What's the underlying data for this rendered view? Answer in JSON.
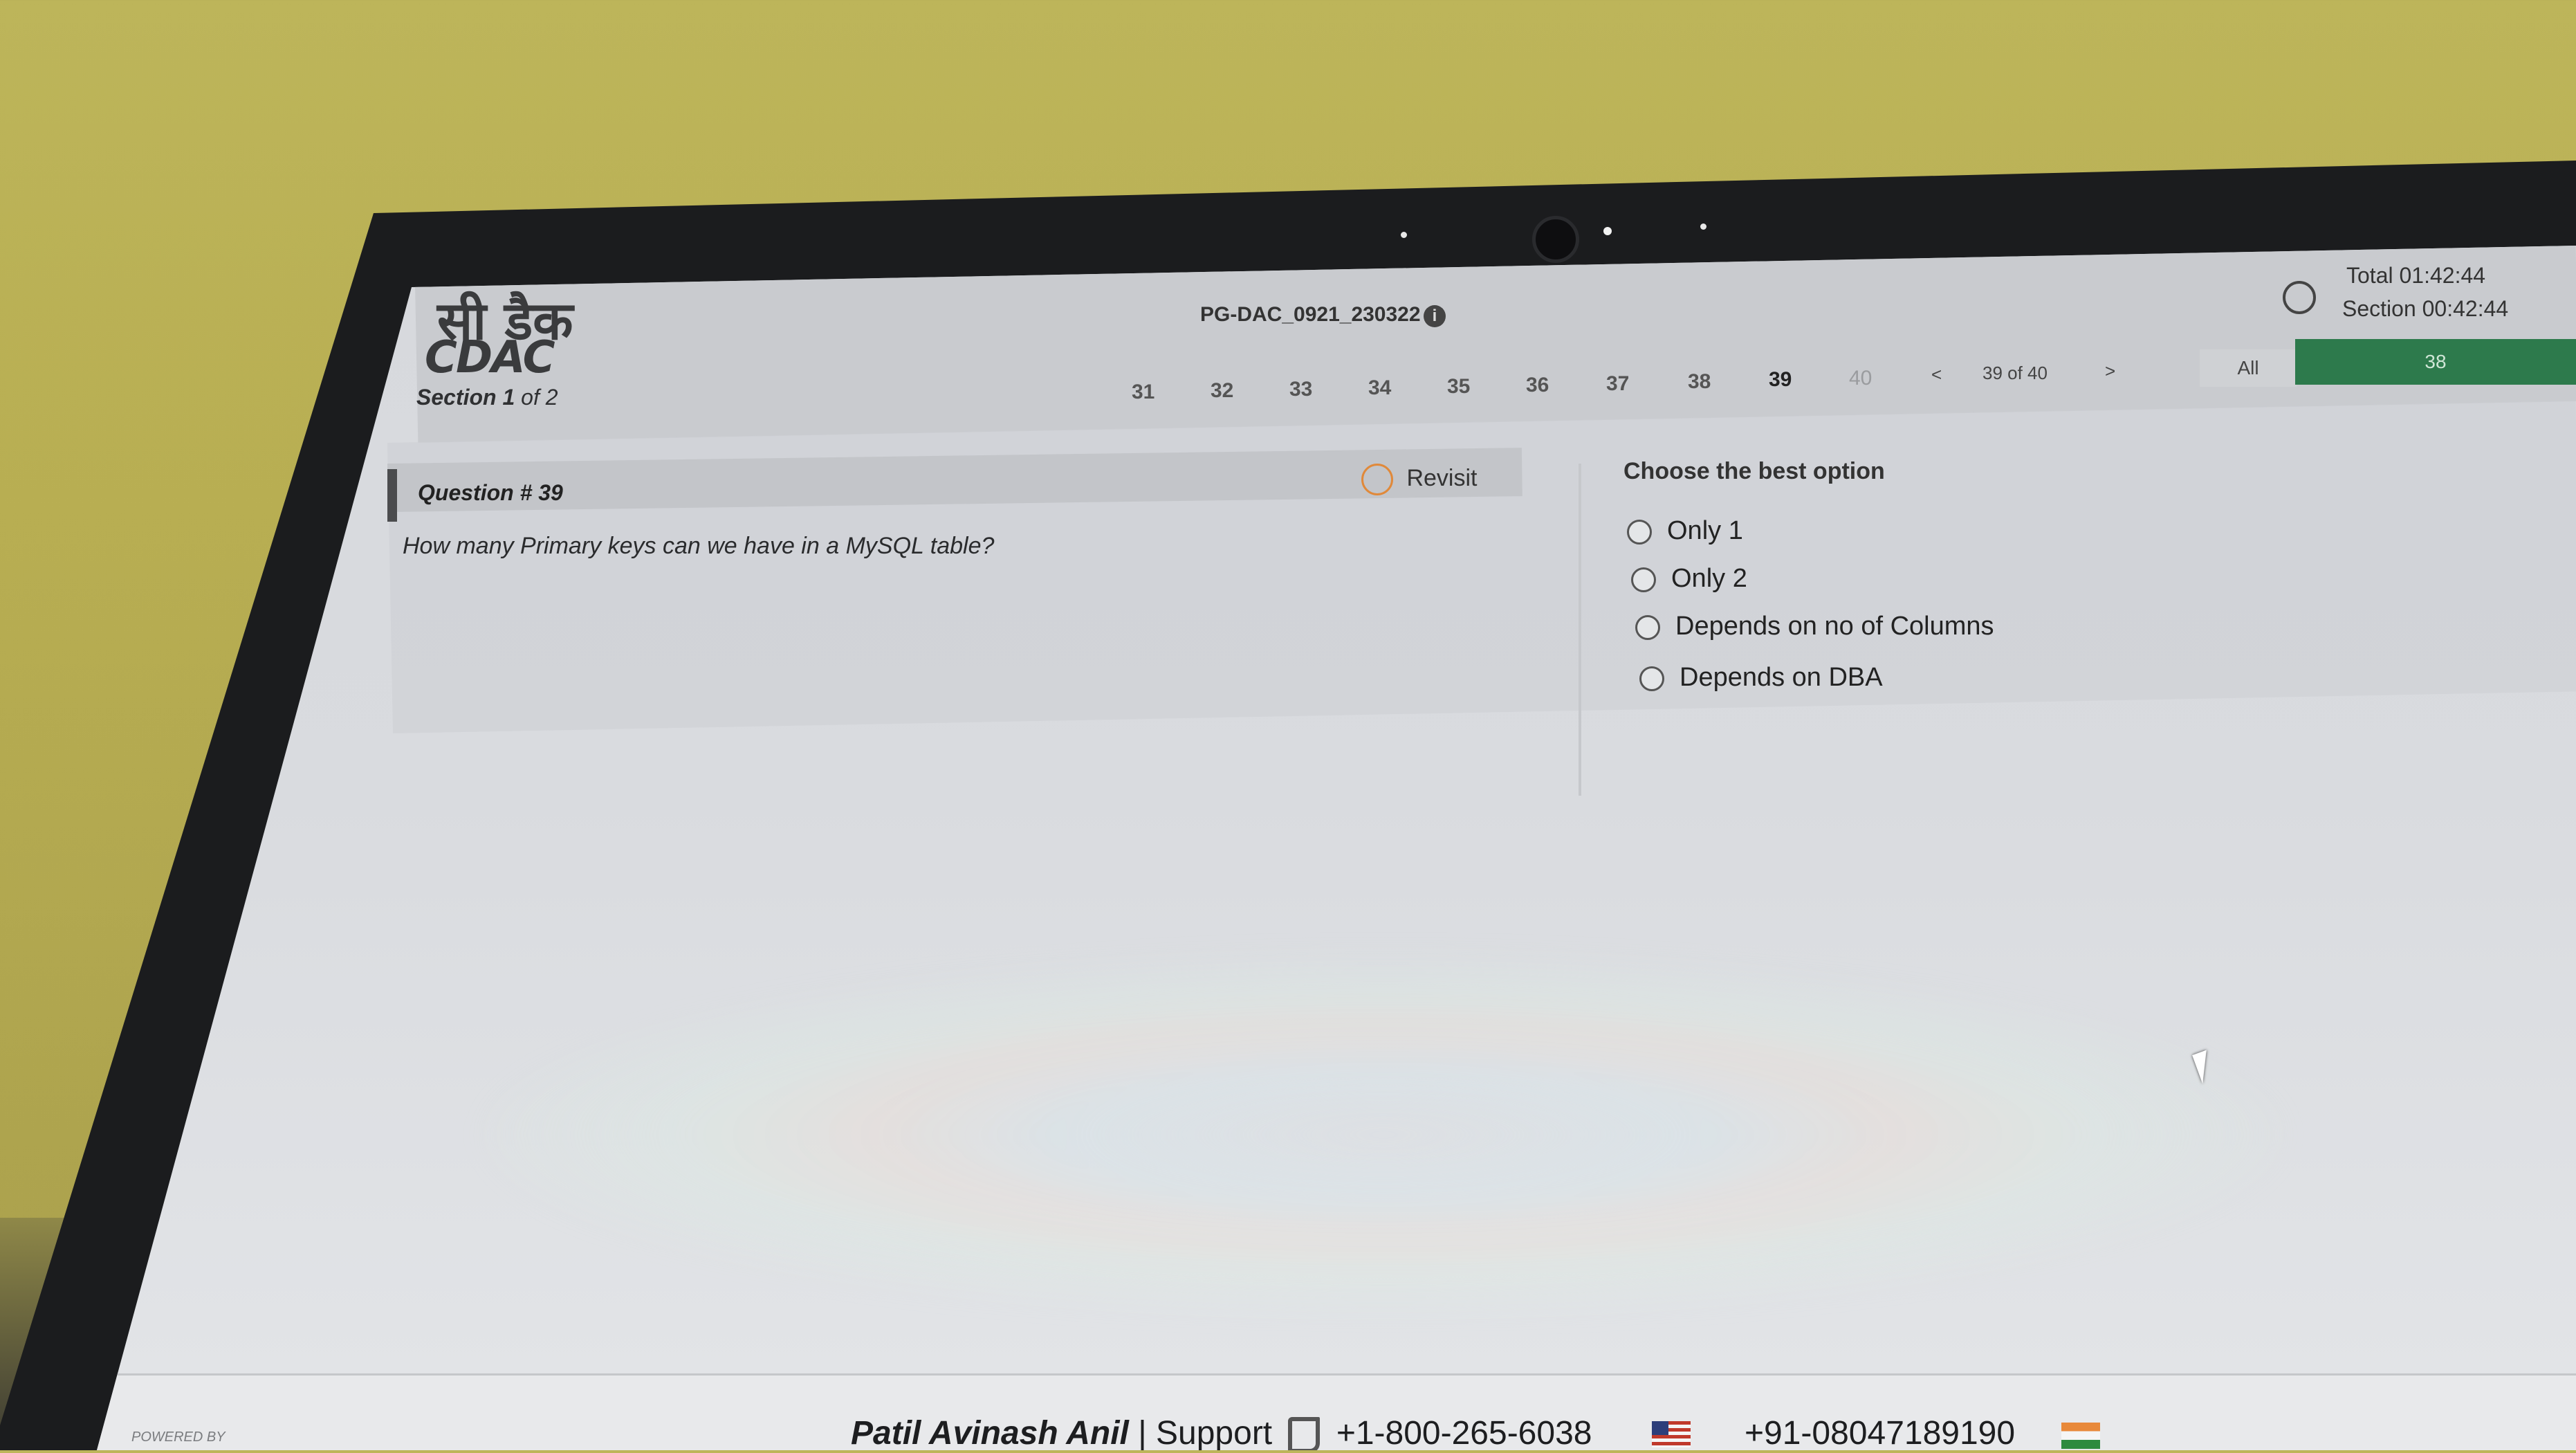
{
  "header": {
    "logo_hindi": "सी डैक",
    "logo_english": "CDAC",
    "section_prefix": "Section",
    "section_current": "1",
    "section_suffix": "of 2",
    "test_id": "PG-DAC_0921_230322",
    "info_glyph": "i"
  },
  "question_nav": {
    "numbers": [
      "31",
      "32",
      "33",
      "34",
      "35",
      "36",
      "37",
      "38",
      "39",
      "40"
    ],
    "current": "39",
    "prev": "<",
    "position": "39 of 40",
    "next": ">"
  },
  "timer": {
    "total": "Total 01:42:44",
    "section": "Section 00:42:44"
  },
  "filters": {
    "all_label": "All",
    "answered_count": "38",
    "answered_color": "#2d7a4c"
  },
  "question": {
    "title": "Question # 39",
    "revisit_label": "Revisit",
    "text": "How many Primary keys can we have in a MySQL table?"
  },
  "options": {
    "heading": "Choose the best option",
    "items": [
      "Only 1",
      "Only 2",
      "Depends on no of Columns",
      "Depends on DBA"
    ]
  },
  "footer": {
    "powered_by": "POWERED BY",
    "candidate_name": "Patil Avinash Anil",
    "separator": "|",
    "support_label": "Support",
    "phone_us": "+1-800-265-6038",
    "phone_in": "+91-08047189190"
  },
  "icons": {
    "clock": "clock-icon",
    "phone": "phone-icon",
    "revisit": "pencil-icon",
    "cursor": "mouse-cursor-icon"
  }
}
